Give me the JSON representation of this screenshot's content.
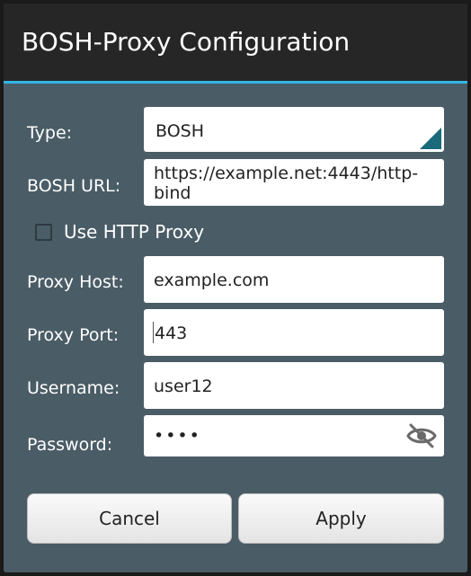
{
  "dialog": {
    "title": "BOSH-Proxy Configuration",
    "accent_color": "#33b5e5"
  },
  "form": {
    "type_label": "Type:",
    "type_value": "BOSH",
    "bosh_url_label": "BOSH URL:",
    "bosh_url_value": "https://example.net:4443/http-bind",
    "use_http_proxy_label": "Use HTTP Proxy",
    "use_http_proxy_checked": false,
    "proxy_host_label": "Proxy Host:",
    "proxy_host_value": "example.com",
    "proxy_port_label": "Proxy Port:",
    "proxy_port_value": "443",
    "username_label": "Username:",
    "username_value": "user12",
    "password_label": "Password:",
    "password_value": "••••",
    "password_toggle_icon": "eye-off-icon"
  },
  "buttons": {
    "cancel_label": "Cancel",
    "apply_label": "Apply"
  }
}
